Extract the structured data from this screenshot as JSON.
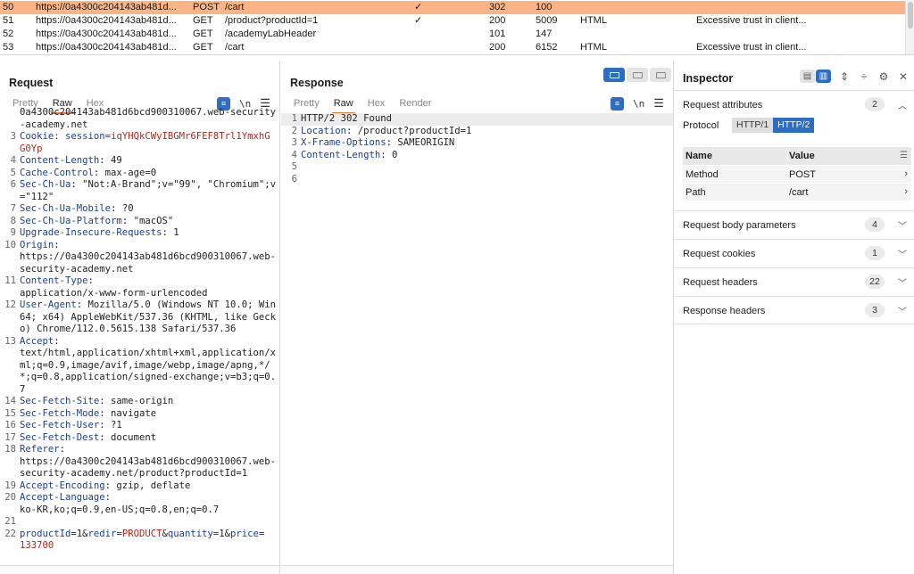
{
  "history": {
    "rows": [
      {
        "num": "50",
        "host": "https://0a4300c204143ab481d...",
        "method": "POST",
        "url": "/cart",
        "edited": "✓",
        "status": "302",
        "length": "100",
        "mime": "",
        "title": "",
        "selected": true
      },
      {
        "num": "51",
        "host": "https://0a4300c204143ab481d...",
        "method": "GET",
        "url": "/product?productId=1",
        "edited": "✓",
        "status": "200",
        "length": "5009",
        "mime": "HTML",
        "title": "Excessive trust in client...",
        "selected": false
      },
      {
        "num": "52",
        "host": "https://0a4300c204143ab481d...",
        "method": "GET",
        "url": "/academyLabHeader",
        "edited": "",
        "status": "101",
        "length": "147",
        "mime": "",
        "title": "",
        "selected": false
      },
      {
        "num": "53",
        "host": "https://0a4300c204143ab481d...",
        "method": "GET",
        "url": "/cart",
        "edited": "",
        "status": "200",
        "length": "6152",
        "mime": "HTML",
        "title": "Excessive trust in client...",
        "selected": false
      }
    ]
  },
  "request": {
    "title": "Request",
    "tabs": [
      "Pretty",
      "Raw",
      "Hex"
    ],
    "active_tab": "Raw",
    "newline_label": "\\n",
    "lines": [
      {
        "n": "",
        "parts": [
          {
            "t": "0a4300c204143ab481d6bcd900310067.web-security-academy.net",
            "c": "v"
          }
        ]
      },
      {
        "n": "3",
        "parts": [
          {
            "t": "Cookie: session=",
            "c": "k"
          },
          {
            "t": "iqYHQkCWyIBGMr6FEF8Trl1YmxhGG0Yp",
            "c": "vr"
          }
        ]
      },
      {
        "n": "4",
        "parts": [
          {
            "t": "Content-Length",
            "c": "k"
          },
          {
            "t": ": 49",
            "c": "v"
          }
        ]
      },
      {
        "n": "5",
        "parts": [
          {
            "t": "Cache-Control",
            "c": "k"
          },
          {
            "t": ": max-age=0",
            "c": "v"
          }
        ]
      },
      {
        "n": "6",
        "parts": [
          {
            "t": "Sec-Ch-Ua",
            "c": "k"
          },
          {
            "t": ": \"Not:A-Brand\";v=\"99\", \"Chromium\";v=\"112\"",
            "c": "v"
          }
        ]
      },
      {
        "n": "7",
        "parts": [
          {
            "t": "Sec-Ch-Ua-Mobile",
            "c": "k"
          },
          {
            "t": ": ?0",
            "c": "v"
          }
        ]
      },
      {
        "n": "8",
        "parts": [
          {
            "t": "Sec-Ch-Ua-Platform",
            "c": "k"
          },
          {
            "t": ": \"macOS\"",
            "c": "v"
          }
        ]
      },
      {
        "n": "9",
        "parts": [
          {
            "t": "Upgrade-Insecure-Requests",
            "c": "k"
          },
          {
            "t": ": 1",
            "c": "v"
          }
        ]
      },
      {
        "n": "10",
        "parts": [
          {
            "t": "Origin",
            "c": "k"
          },
          {
            "t": ":\nhttps://0a4300c204143ab481d6bcd900310067.web-security-academy.net",
            "c": "v"
          }
        ]
      },
      {
        "n": "11",
        "parts": [
          {
            "t": "Content-Type",
            "c": "k"
          },
          {
            "t": ":\napplication/x-www-form-urlencoded",
            "c": "v"
          }
        ]
      },
      {
        "n": "12",
        "parts": [
          {
            "t": "User-Agent",
            "c": "k"
          },
          {
            "t": ": Mozilla/5.0 (Windows NT 10.0; Win64; x64) AppleWebKit/537.36 (KHTML, like Gecko) Chrome/112.0.5615.138 Safari/537.36",
            "c": "v"
          }
        ]
      },
      {
        "n": "13",
        "parts": [
          {
            "t": "Accept",
            "c": "k"
          },
          {
            "t": ":\ntext/html,application/xhtml+xml,application/xml;q=0.9,image/avif,image/webp,image/apng,*/*;q=0.8,application/signed-exchange;v=b3;q=0.7",
            "c": "v"
          }
        ]
      },
      {
        "n": "14",
        "parts": [
          {
            "t": "Sec-Fetch-Site",
            "c": "k"
          },
          {
            "t": ": same-origin",
            "c": "v"
          }
        ]
      },
      {
        "n": "15",
        "parts": [
          {
            "t": "Sec-Fetch-Mode",
            "c": "k"
          },
          {
            "t": ": navigate",
            "c": "v"
          }
        ]
      },
      {
        "n": "16",
        "parts": [
          {
            "t": "Sec-Fetch-User",
            "c": "k"
          },
          {
            "t": ": ?1",
            "c": "v"
          }
        ]
      },
      {
        "n": "17",
        "parts": [
          {
            "t": "Sec-Fetch-Dest",
            "c": "k"
          },
          {
            "t": ": document",
            "c": "v"
          }
        ]
      },
      {
        "n": "18",
        "parts": [
          {
            "t": "Referer",
            "c": "k"
          },
          {
            "t": ":\nhttps://0a4300c204143ab481d6bcd900310067.web-security-academy.net/product?productId=1",
            "c": "v"
          }
        ]
      },
      {
        "n": "19",
        "parts": [
          {
            "t": "Accept-Encoding",
            "c": "k"
          },
          {
            "t": ": gzip, deflate",
            "c": "v"
          }
        ]
      },
      {
        "n": "20",
        "parts": [
          {
            "t": "Accept-Language",
            "c": "k"
          },
          {
            "t": ":\nko-KR,ko;q=0.9,en-US;q=0.8,en;q=0.7",
            "c": "v"
          }
        ]
      },
      {
        "n": "21",
        "parts": [
          {
            "t": " ",
            "c": "v"
          }
        ]
      },
      {
        "n": "22",
        "parts": [
          {
            "t": "productId",
            "c": "k"
          },
          {
            "t": "=1&",
            "c": "v"
          },
          {
            "t": "redir",
            "c": "k"
          },
          {
            "t": "=",
            "c": "v"
          },
          {
            "t": "PRODUCT",
            "c": "vr"
          },
          {
            "t": "&",
            "c": "v"
          },
          {
            "t": "quantity",
            "c": "k"
          },
          {
            "t": "=1&",
            "c": "v"
          },
          {
            "t": "price",
            "c": "k"
          },
          {
            "t": "=\n",
            "c": "v"
          },
          {
            "t": "133700",
            "c": "vr"
          }
        ]
      }
    ]
  },
  "response": {
    "title": "Response",
    "tabs": [
      "Pretty",
      "Raw",
      "Hex",
      "Render"
    ],
    "active_tab": "Raw",
    "newline_label": "\\n",
    "lines": [
      {
        "n": "1",
        "parts": [
          {
            "t": "HTTP/2 302 Found",
            "c": "v"
          }
        ],
        "hl": true
      },
      {
        "n": "2",
        "parts": [
          {
            "t": "Location",
            "c": "k"
          },
          {
            "t": ": /product?productId=1",
            "c": "v"
          }
        ]
      },
      {
        "n": "3",
        "parts": [
          {
            "t": "X-Frame-Options",
            "c": "k"
          },
          {
            "t": ": SAMEORIGIN",
            "c": "v"
          }
        ]
      },
      {
        "n": "4",
        "parts": [
          {
            "t": "Content-Length",
            "c": "k"
          },
          {
            "t": ": 0",
            "c": "v"
          }
        ]
      },
      {
        "n": "5",
        "parts": [
          {
            "t": " ",
            "c": "v"
          }
        ]
      },
      {
        "n": "6",
        "parts": [
          {
            "t": " ",
            "c": "v"
          }
        ]
      }
    ]
  },
  "inspector": {
    "title": "Inspector",
    "request_attributes": {
      "label": "Request attributes",
      "count": "2",
      "protocol_label": "Protocol",
      "protocol_options": [
        "HTTP/1",
        "HTTP/2"
      ],
      "protocol_selected": "HTTP/2",
      "table_headers": [
        "Name",
        "Value"
      ],
      "rows": [
        {
          "name": "Method",
          "value": "POST"
        },
        {
          "name": "Path",
          "value": "/cart"
        }
      ]
    },
    "sections": [
      {
        "label": "Request body parameters",
        "count": "4"
      },
      {
        "label": "Request cookies",
        "count": "1"
      },
      {
        "label": "Request headers",
        "count": "22"
      },
      {
        "label": "Response headers",
        "count": "3"
      }
    ]
  }
}
